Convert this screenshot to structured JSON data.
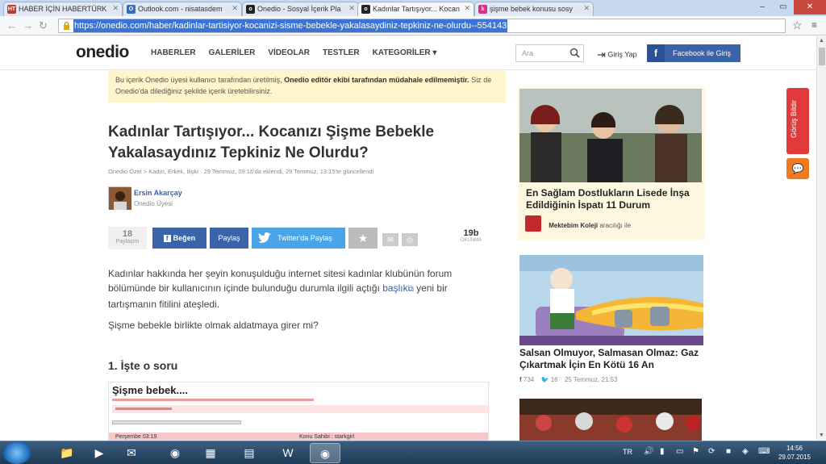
{
  "browser": {
    "tabs": [
      {
        "label": "HABER İÇİN HABERTÜRK",
        "icon": "HT",
        "color": "#c0392b"
      },
      {
        "label": "Outlook.com - nisatasdem",
        "icon": "O",
        "color": "#2f6fbf"
      },
      {
        "label": "Onedio - Sosyal İçerik Pla",
        "icon": "o",
        "color": "#222222"
      },
      {
        "label": "Kadınlar Tartışıyor... Kocan",
        "icon": "o",
        "color": "#222222"
      },
      {
        "label": "şişme bebek konusu sosy",
        "icon": "k",
        "color": "#d63384"
      }
    ],
    "url": "https://onedio.com/haber/kadinlar-tartisiyor-kocanizi-sisme-bebekle-yakalasaydiniz-tepkiniz-ne-olurdu--554143"
  },
  "header": {
    "logo": "onedio",
    "nav": [
      "HABERLER",
      "GALERİLER",
      "VİDEOLAR",
      "TESTLER",
      "KATEGORİLER"
    ],
    "search_placeholder": "Ara",
    "login": "Giriş Yap",
    "facebook_login": "Facebook ile Giriş"
  },
  "notice": {
    "part1": "Bu içerik Onedio üyesi kullanıcı tarafından üretilmiş,",
    "bold": "Onedio editör ekibi tarafından müdahale edilmemiştir.",
    "part2": "Siz de Onedio'da dilediğiniz şekilde içerik üretebilirsiniz."
  },
  "article": {
    "title": "Kadınlar Tartışıyor... Kocanızı Şişme Bebekle Yakalasaydınız Tepkiniz Ne Olurdu?",
    "meta": "Onedio Özel > Kadın, Erkek, İlişki · 29 Temmuz, 09:16'da eklendi, 29 Temmuz, 13:15'te güncellendi",
    "author_name": "Ersin Akarçay",
    "author_role": "Onedio Üyesi",
    "likes_count": "18",
    "likes_label": "Paylaşım",
    "like_button": "Beğen",
    "share_button": "Paylaş",
    "tweet_button": "Twitter'da Paylaş",
    "reads_count": "19b",
    "reads_label": "OKUNMA",
    "p1_text": "Kadınlar hakkında her şeyin konuşulduğu internet sitesi kadınlar klubünün forum bölümünde bir kullanıcının içinde bulunduğu durumla ilgili açtığı",
    "p1_link": "başlık",
    "p1_end": "yeni bir tartışmanın fitilini ateşledi.",
    "p2": "Şişme bebekle birlikte olmak aldatmaya girer mi?",
    "h2": "1. İşte o soru"
  },
  "forum": {
    "title": "Şişme bebek....",
    "row_date": "Perşembe 03:19",
    "row_owner": "Konu Sahibi : starkgirl"
  },
  "sidebar": {
    "card1_title": "En Sağlam Dostlukların Lisede İnşa Edildiğinin İspatı 11 Durum",
    "card1_sponsor": "Mektebim Koleji",
    "card1_sponsor_suffix": "aracılığı ile",
    "card2_title": "Salsan Olmuyor, Salmasan Olmaz: Gaz Çıkartmak İçin En Kötü 16 An",
    "card2_fb": "734",
    "card2_tw": "16",
    "card2_date": "25 Temmuz, 21:53",
    "feedback": "Görüş Bildir"
  },
  "taskbar": {
    "lang": "TR",
    "time": "14:56",
    "date": "29.07.2015"
  }
}
